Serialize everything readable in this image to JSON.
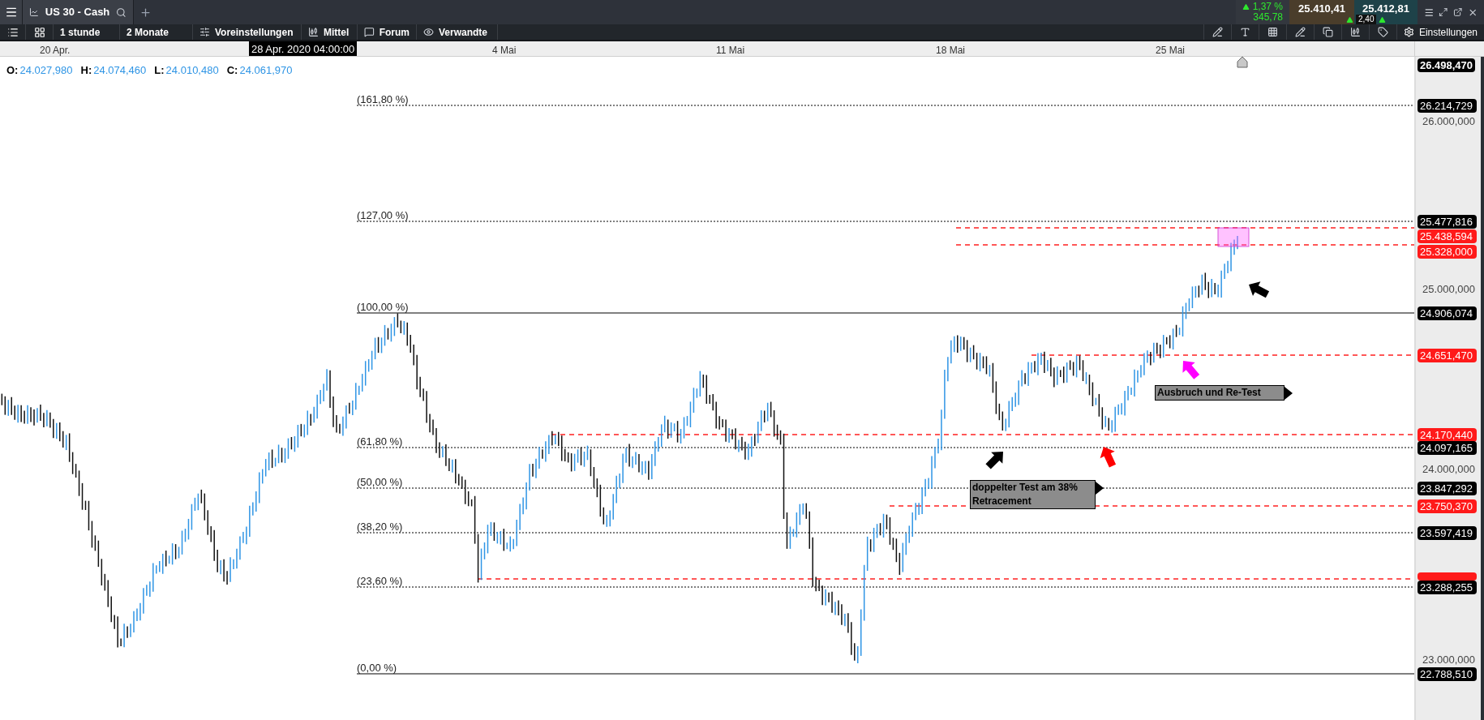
{
  "top_bar": {
    "tab_title": "US 30 - Cash",
    "change": {
      "percent": "1,37 %",
      "points": "345,78"
    },
    "sell_price": "25.410,41",
    "spread": "2,40",
    "buy_price": "25.412,81"
  },
  "toolbar": {
    "items": [
      {
        "label": "1 stunde"
      },
      {
        "label": "2 Monate"
      },
      {
        "label": "Voreinstellungen"
      },
      {
        "label": "Mittel"
      },
      {
        "label": "Forum"
      },
      {
        "label": "Verwandte"
      }
    ],
    "settings_label": "Einstellungen"
  },
  "time_axis": {
    "labels": [
      "20 Apr.",
      "4 Mai",
      "11 Mai",
      "18 Mai",
      "25 Mai"
    ],
    "cursor_label": "28 Apr. 2020 04:00:00"
  },
  "ohlc": [
    {
      "key": "O:",
      "value": "24.027,980"
    },
    {
      "key": "H:",
      "value": "24.074,460"
    },
    {
      "key": "L:",
      "value": "24.010,480"
    },
    {
      "key": "C:",
      "value": "24.061,970"
    }
  ],
  "price_axis": {
    "top_tag": "26.498,470",
    "ticks": [
      "26.000,000",
      "25.000,000",
      "24.000,000",
      "23.000,000"
    ]
  },
  "fib_levels": [
    {
      "label": "(161,80 %)",
      "price": "26.214,729",
      "kind": "dotted"
    },
    {
      "label": "(127,00 %)",
      "price": "25.477,816",
      "kind": "dotted"
    },
    {
      "label": "(100,00 %)",
      "price": "24.906,074",
      "kind": "solid"
    },
    {
      "label": "(61,80 %)",
      "price": "24.097,165",
      "kind": "dotted"
    },
    {
      "label": "(50,00 %)",
      "price": "23.847,292",
      "kind": "dotted"
    },
    {
      "label": "(38,20 %)",
      "price": "23.597,419",
      "kind": "dotted"
    },
    {
      "label": "(23,60 %)",
      "price": "23.288,255",
      "kind": "dotted"
    },
    {
      "label": "(0,00 %)",
      "price": "22.788,510",
      "kind": "solid"
    }
  ],
  "lines": [
    {
      "price": "25.438,594"
    },
    {
      "price": "25.328,000"
    },
    {
      "price": "24.651,470"
    },
    {
      "price": "24.170,440"
    },
    {
      "price": "23.750,370"
    }
  ],
  "notes": [
    {
      "text": "doppelter Test am 38% Retracement"
    },
    {
      "text": "Ausbruch und Re-Test"
    }
  ],
  "arrows": [
    {
      "color": "#000000"
    },
    {
      "color": "#ff0000"
    },
    {
      "color": "#ff00ff"
    },
    {
      "color": "#000000"
    }
  ]
}
